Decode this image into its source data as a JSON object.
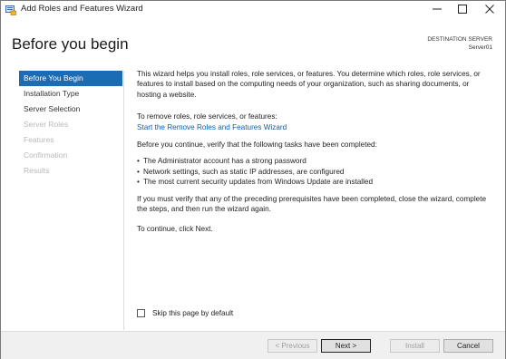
{
  "window": {
    "title": "Add Roles and Features Wizard"
  },
  "header": {
    "title": "Before you begin",
    "destination_label": "DESTINATION SERVER",
    "destination_value": "Server01"
  },
  "nav": {
    "items": [
      {
        "label": "Before You Begin",
        "state": "active"
      },
      {
        "label": "Installation Type",
        "state": "enabled"
      },
      {
        "label": "Server Selection",
        "state": "enabled"
      },
      {
        "label": "Server Roles",
        "state": "disabled"
      },
      {
        "label": "Features",
        "state": "disabled"
      },
      {
        "label": "Confirmation",
        "state": "disabled"
      },
      {
        "label": "Results",
        "state": "disabled"
      }
    ]
  },
  "content": {
    "intro": "This wizard helps you install roles, role services, or features. You determine which roles, role services, or features to install based on the computing needs of your organization, such as sharing documents, or hosting a website.",
    "remove_text": "To remove roles, role services, or features:",
    "remove_link": "Start the Remove Roles and Features Wizard",
    "verify_text": "Before you continue, verify that the following tasks have been completed:",
    "bullets": [
      "The Administrator account has a strong password",
      "Network settings, such as static IP addresses, are configured",
      "The most current security updates from Windows Update are installed"
    ],
    "prereq_text": "If you must verify that any of the preceding prerequisites have been completed, close the wizard, complete the steps, and then run the wizard again.",
    "continue_text": "To continue, click Next."
  },
  "skip_checkbox": {
    "label": "Skip this page by default",
    "checked": false
  },
  "buttons": {
    "previous": "< Previous",
    "next": "Next >",
    "install": "Install",
    "cancel": "Cancel"
  },
  "colors": {
    "accent": "#1c6bb5",
    "link": "#0a5fb0"
  },
  "icons": {
    "app": "server-wizard-icon",
    "minimize": "minimize-icon",
    "maximize": "maximize-icon",
    "close": "close-icon"
  }
}
